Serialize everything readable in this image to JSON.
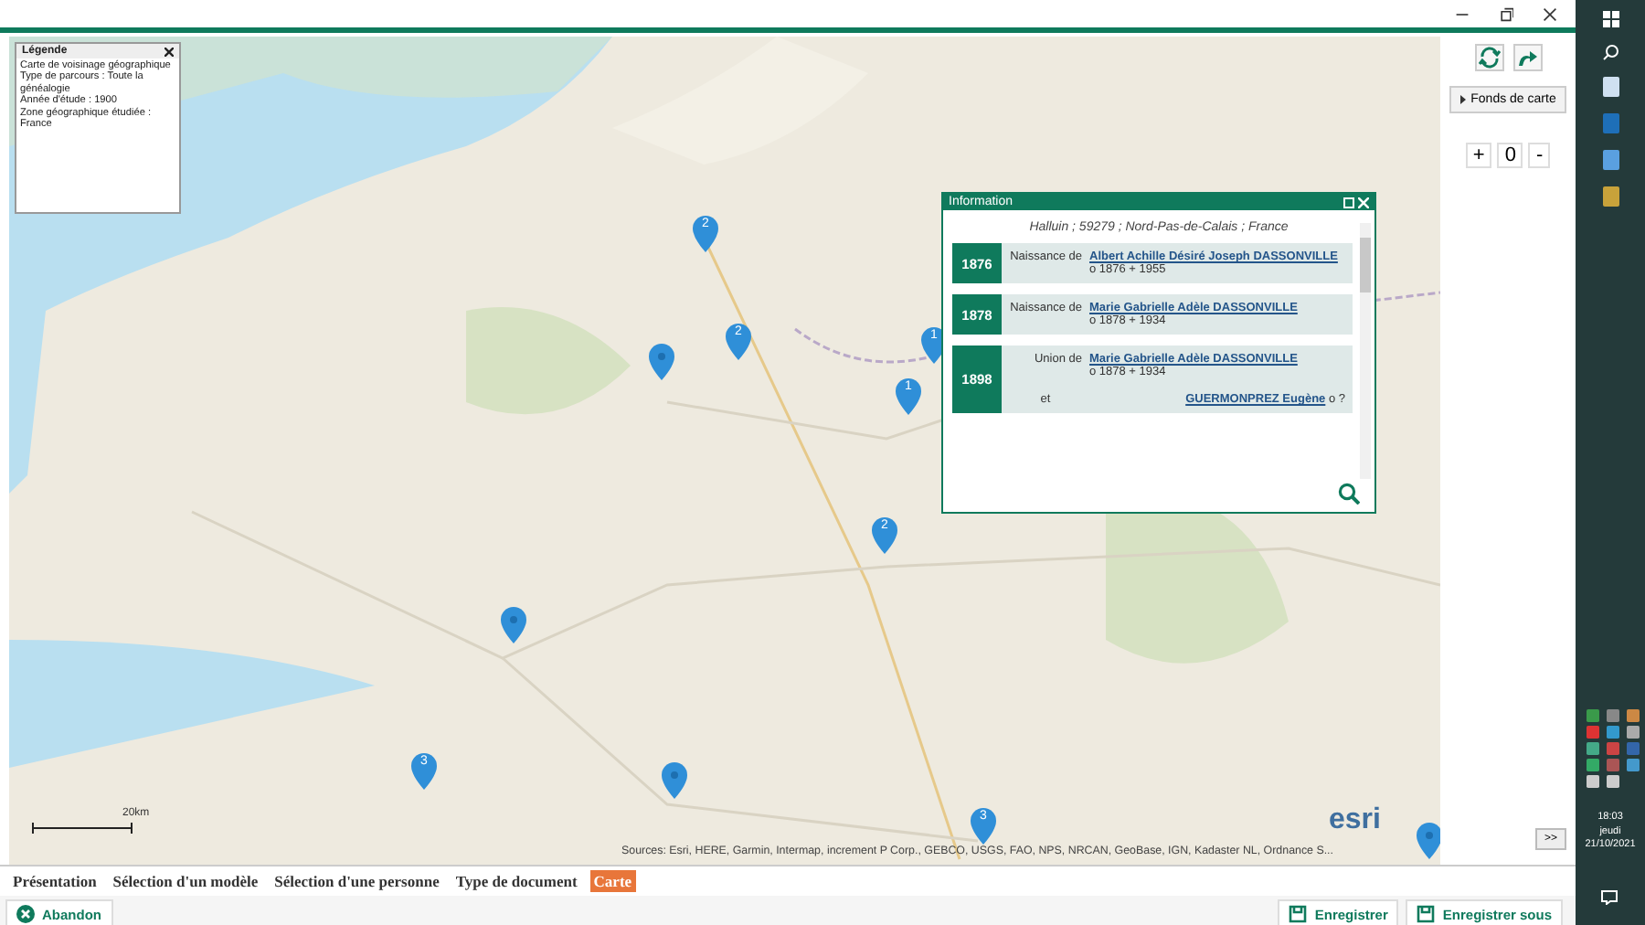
{
  "legend": {
    "title": "Légende",
    "lines": [
      "Carte de voisinage géographique",
      "Type de parcours :  Toute la généalogie",
      "Année d'étude : 1900",
      "Zone géographique étudiée : France"
    ]
  },
  "map": {
    "markers": [
      {
        "kind": "cluster",
        "label": "2"
      },
      {
        "kind": "cluster",
        "label": "2"
      },
      {
        "kind": "single"
      },
      {
        "kind": "cluster",
        "label": "1"
      },
      {
        "kind": "cluster",
        "label": "1"
      },
      {
        "kind": "cluster",
        "label": "2"
      },
      {
        "kind": "single"
      },
      {
        "kind": "cluster",
        "label": "3"
      },
      {
        "kind": "single"
      },
      {
        "kind": "cluster",
        "label": "3"
      },
      {
        "kind": "single"
      }
    ],
    "scale": "20km",
    "attribution": "Sources: Esri, HERE, Garmin, Intermap, increment P Corp., GEBCO, USGS, FAO, NPS, NRCAN, GeoBase, IGN, Kadaster NL, Ordnance S...",
    "logo": "esri"
  },
  "info": {
    "title": "Information",
    "place": "Halluin ; 59279 ; Nord-Pas-de-Calais ; France",
    "events": [
      {
        "year": "1876",
        "kind": "single",
        "role": "Naissance de",
        "person": "Albert Achille Désiré Joseph DASSONVILLE",
        "dates": "o 1876    + 1955"
      },
      {
        "year": "1878",
        "kind": "single",
        "role": "Naissance de",
        "person": "Marie Gabrielle Adèle DASSONVILLE",
        "dates": "o 1878    + 1934"
      },
      {
        "year": "1898",
        "kind": "union",
        "role": "Union de",
        "person": "Marie Gabrielle Adèle DASSONVILLE",
        "dates": "o 1878    + 1934",
        "and": "et",
        "partner": "GUERMONPREZ Eugène",
        "partner_dates": "o ?"
      }
    ]
  },
  "side": {
    "basemap_button": "Fonds de carte",
    "zoom": {
      "plus": "+",
      "value": "0",
      "minus": "-"
    },
    "expand": ">>"
  },
  "steps": [
    {
      "label": "Présentation",
      "selected": false
    },
    {
      "label": "Sélection d'un modèle",
      "selected": false
    },
    {
      "label": "Sélection d'une personne",
      "selected": false
    },
    {
      "label": "Type de document",
      "selected": false
    },
    {
      "label": "Carte",
      "selected": true
    }
  ],
  "actions": {
    "cancel": "Abandon",
    "save": "Enregistrer",
    "save_as": "Enregistrer sous"
  },
  "taskbar": {
    "time": "18:03",
    "day": "jeudi",
    "date": "21/10/2021"
  }
}
